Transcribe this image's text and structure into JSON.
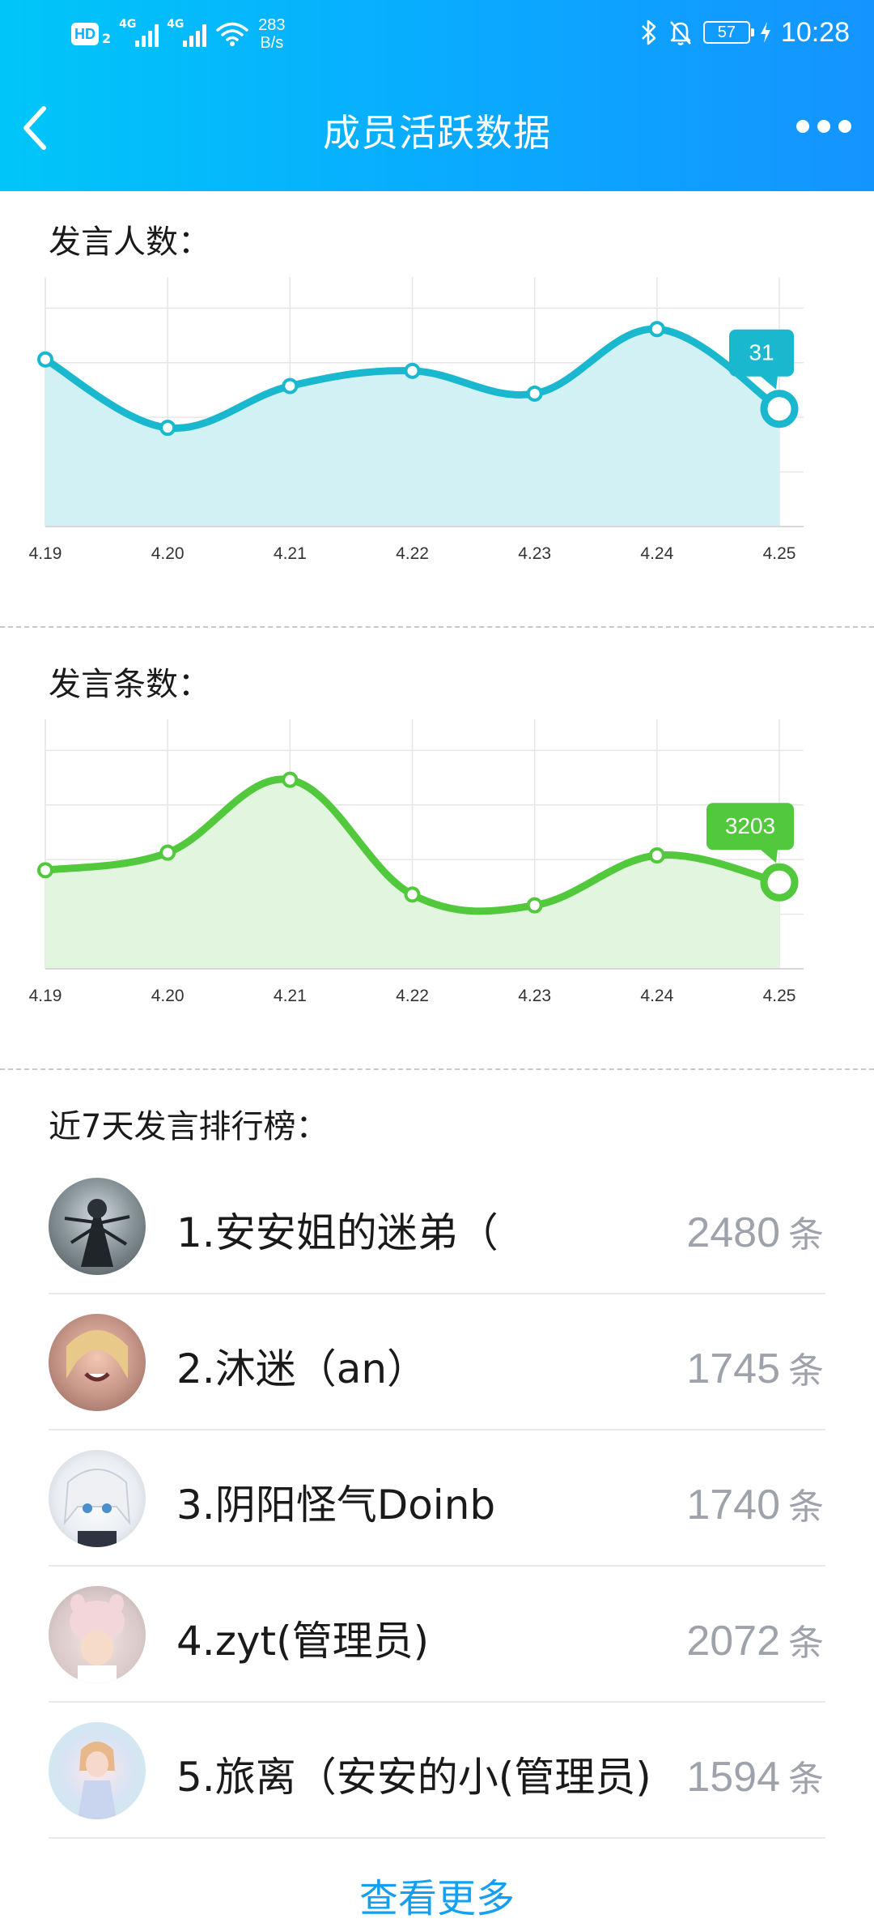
{
  "status_bar": {
    "hd_label": "HD",
    "sim_index": "2",
    "network1": "4G",
    "network2": "4G",
    "speed_value": "283",
    "speed_unit": "B/s",
    "battery": "57",
    "time": "10:28",
    "icons": [
      "bluetooth-icon",
      "mute-bell-icon",
      "charging-icon",
      "wifi-icon"
    ]
  },
  "header": {
    "title": "成员活跃数据",
    "back_icon": "chevron-left-icon",
    "more_icon": "more-dots-icon"
  },
  "colors": {
    "header_gradient_start": "#00c6f8",
    "header_gradient_end": "#1494ff",
    "chart1_line": "#1ab8cf",
    "chart1_fill": "#d2f1f5",
    "chart2_line": "#52c83c",
    "chart2_fill": "#e2f5de",
    "rank_count": "#9ea2ab",
    "link": "#14a0f2"
  },
  "speakers_section": {
    "title": "发言人数："
  },
  "messages_section": {
    "title": "发言条数："
  },
  "ranking_section": {
    "title": "近7天发言排行榜：",
    "unit": "条",
    "items": [
      {
        "name": "1.安安姐的迷弟（",
        "count": "2480"
      },
      {
        "name": "2.沐迷（an）",
        "count": "1745"
      },
      {
        "name": "3.阴阳怪气Doinb",
        "count": "1740"
      },
      {
        "name": "4.zyt(管理员)",
        "count": "2072"
      },
      {
        "name": "5.旅离（安安的小(管理员)",
        "count": "1594"
      }
    ],
    "more_label": "查看更多"
  },
  "chart_data": [
    {
      "type": "area",
      "title": "发言人数：",
      "categories": [
        "4.19",
        "4.20",
        "4.21",
        "4.22",
        "4.23",
        "4.24",
        "4.25"
      ],
      "values": [
        44,
        26,
        37,
        41,
        35,
        52,
        31
      ],
      "ylim": [
        0,
        64
      ],
      "grid": true,
      "highlight": {
        "index": 6,
        "label": "31"
      }
    },
    {
      "type": "area",
      "title": "发言条数：",
      "categories": [
        "4.19",
        "4.20",
        "4.21",
        "4.22",
        "4.23",
        "4.24",
        "4.25"
      ],
      "values": [
        3650,
        4300,
        7000,
        2750,
        2350,
        4200,
        3203
      ],
      "ylim": [
        0,
        9000
      ],
      "grid": true,
      "highlight": {
        "index": 6,
        "label": "3203"
      }
    }
  ]
}
